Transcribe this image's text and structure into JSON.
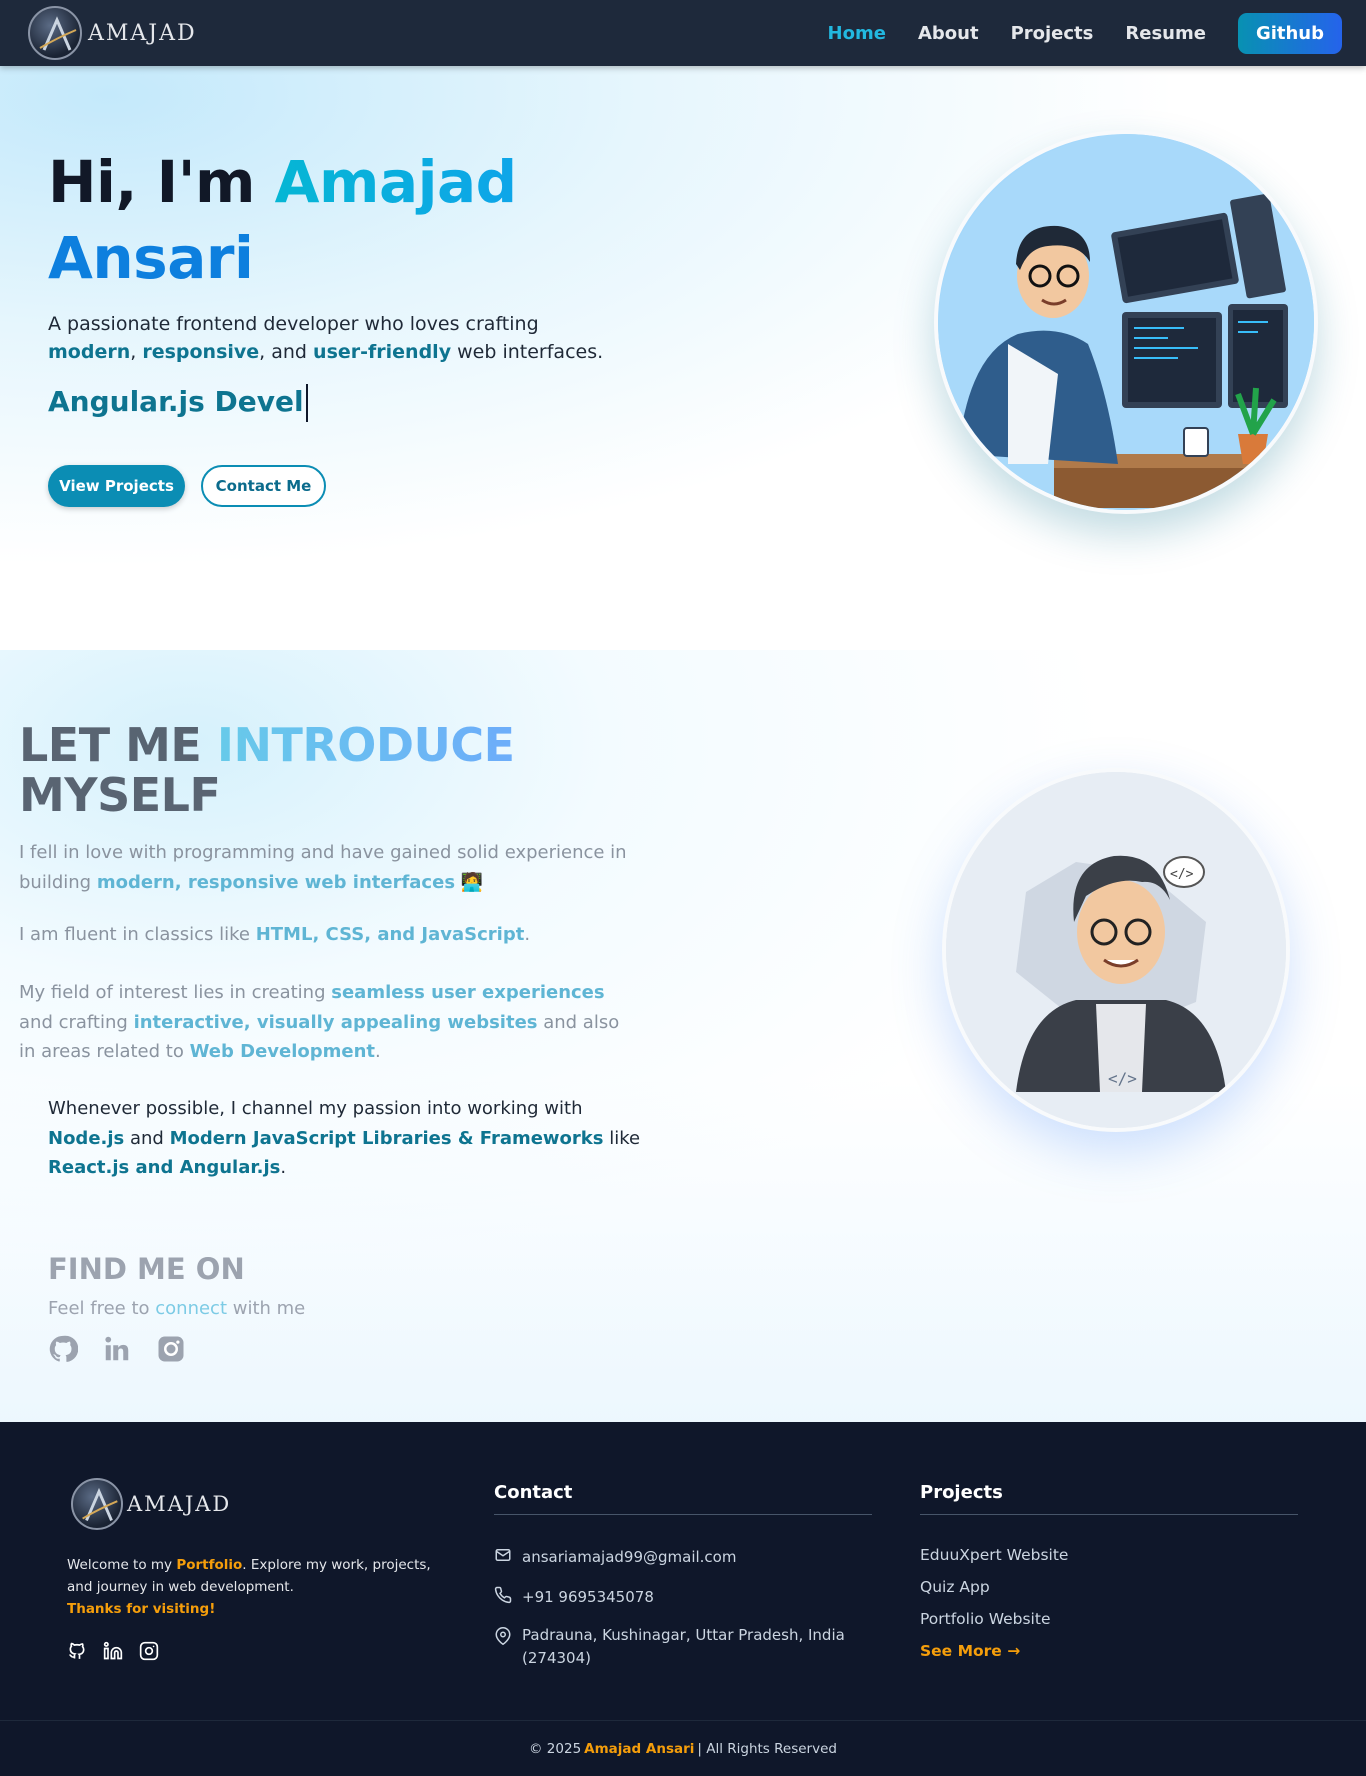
{
  "nav": {
    "brand": "AMAJAD",
    "links": [
      {
        "label": "Home",
        "active": true
      },
      {
        "label": "About",
        "active": false
      },
      {
        "label": "Projects",
        "active": false
      },
      {
        "label": "Resume",
        "active": false
      }
    ],
    "github_label": "Github"
  },
  "hero": {
    "greeting": "Hi, I'm ",
    "first_name": "Amajad",
    "last_name": "Ansari",
    "desc_1": "A passionate frontend developer who loves crafting ",
    "desc_k1": "modern",
    "desc_2": ", ",
    "desc_k2": "responsive",
    "desc_3": ", and ",
    "desc_k3": "user-friendly",
    "desc_4": " web interfaces.",
    "typed_text": "Angular.js Devel",
    "view_projects": "View Projects",
    "contact_me": "Contact Me"
  },
  "intro": {
    "title_1": "LET ME ",
    "title_accent": "INTRODUCE",
    "title_2": "MYSELF",
    "p1_text": "I fell in love with programming and have gained solid experience in building ",
    "p1_k": "modern, responsive web interfaces",
    "p1_emoji": "🧑‍💻",
    "p2_text": "I am fluent in classics like ",
    "p2_k": "HTML, CSS, and JavaScript",
    "p2_end": ".",
    "p3_a": "My field of interest lies in creating ",
    "p3_k1": "seamless user experiences",
    "p3_b": " and crafting ",
    "p3_k2": "interactive, visually appealing websites",
    "p3_c": " and also in areas related to ",
    "p3_k3": "Web Development",
    "p3_end": ".",
    "p4_a": "Whenever possible, I channel my passion into working with ",
    "p4_k1": "Node.js",
    "p4_b": " and ",
    "p4_k2": "Modern JavaScript Libraries & Frameworks",
    "p4_c": " like ",
    "p4_k3": "React.js and Angular.js",
    "p4_end": "."
  },
  "find": {
    "title": "FIND ME ON",
    "sub_a": "Feel free to ",
    "sub_k": "connect",
    "sub_b": " with me",
    "socials": [
      "github-icon",
      "linkedin-icon",
      "instagram-icon"
    ]
  },
  "footer": {
    "brand": "AMAJAD",
    "welcome_a": "Welcome to my ",
    "welcome_k": "Portfolio",
    "welcome_b": ". Explore my work, projects, and journey in web development.",
    "thanks": "Thanks for visiting!",
    "contact_title": "Contact",
    "email": "ansariamajad99@gmail.com",
    "phone": "+91 9695345078",
    "address": "Padrauna, Kushinagar, Uttar Pradesh, India (274304)",
    "projects_title": "Projects",
    "projects": [
      "EduuXpert Website",
      "Quiz App",
      "Portfolio Website"
    ],
    "see_more": "See More →",
    "copyright_a": "© 2025",
    "copyright_name": "Amajad Ansari",
    "copyright_b": "| All Rights Reserved"
  },
  "colors": {
    "nav_bg": "#1e293b",
    "accent_cyan": "#06b6d4",
    "accent_blue": "#0d7fde",
    "footer_bg": "#0f172a",
    "footer_accent": "#f59e0b"
  }
}
